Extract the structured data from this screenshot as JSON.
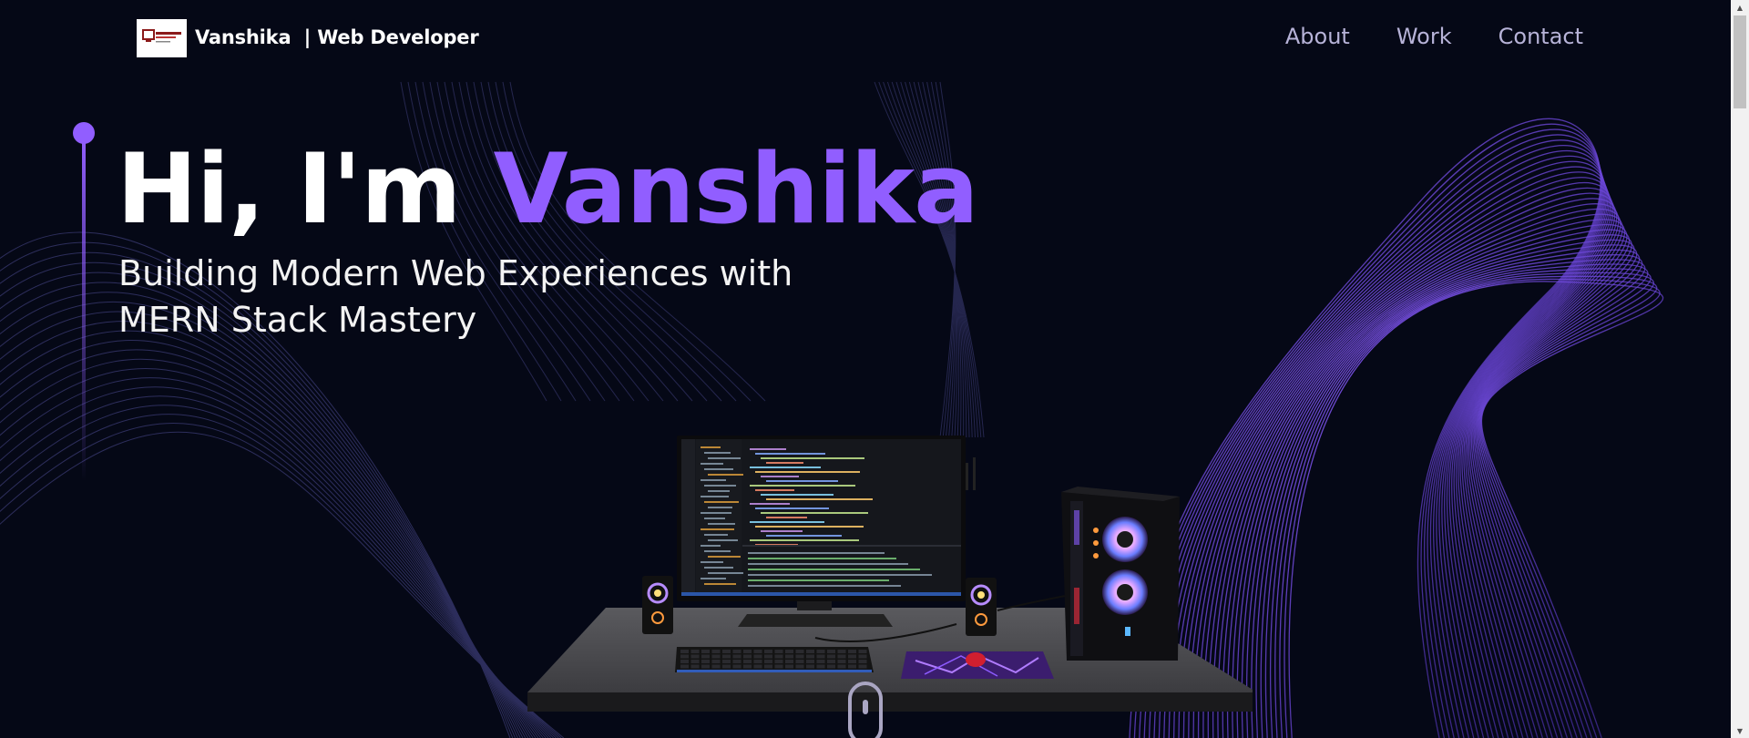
{
  "navbar": {
    "brand": "Vanshika  | Web Developer",
    "links": [
      "About",
      "Work",
      "Contact"
    ]
  },
  "hero": {
    "greeting": "Hi, I'm ",
    "name": "Vanshika",
    "subtitle": "Building Modern Web Experiences with MERN Stack Mastery"
  },
  "colors": {
    "background": "#050816",
    "accent": "#915eff",
    "nav_text": "#b7b3d8",
    "wave_faint": "#3a3a72",
    "wave_bright": "#7b4dff"
  },
  "icons": {
    "logo": "site-logo",
    "scroll": "mouse-scroll-icon",
    "scene": "desk-computer-scene"
  }
}
